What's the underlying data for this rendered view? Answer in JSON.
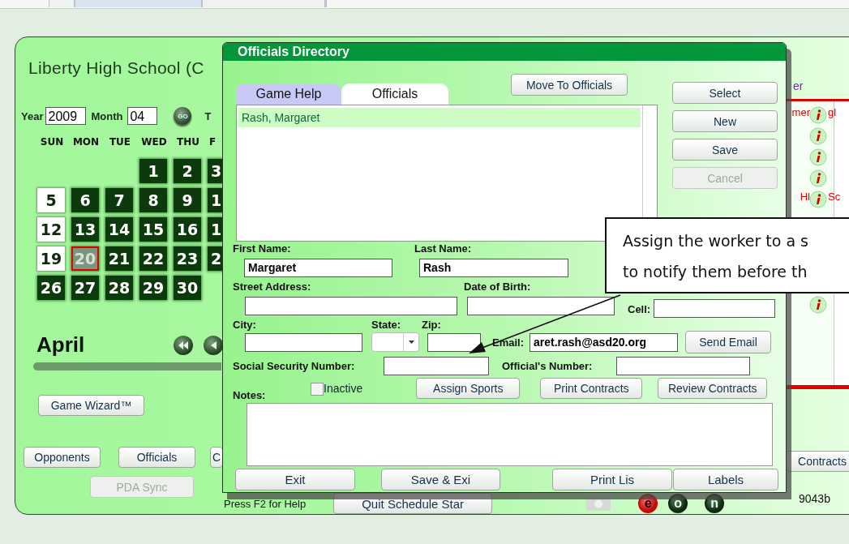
{
  "main": {
    "title": "Liberty High School (C",
    "year_label": "Year",
    "year": "2009",
    "month_label": "Month",
    "month": "04",
    "go_label": "GO",
    "to_label": "T",
    "weekdays": [
      "SUN",
      "MON",
      "TUE",
      "WED",
      "THU",
      "F"
    ],
    "weeks": [
      [
        {
          "kind": "blank"
        },
        {
          "kind": "blank"
        },
        {
          "kind": "blank"
        },
        {
          "kind": "game",
          "label": "1",
          "selected": false
        },
        {
          "kind": "game",
          "label": "2",
          "selected": false
        },
        {
          "kind": "game",
          "label": "3",
          "selected": false
        }
      ],
      [
        {
          "kind": "open",
          "label": "5",
          "selected": false
        },
        {
          "kind": "game",
          "label": "6",
          "selected": false
        },
        {
          "kind": "game",
          "label": "7",
          "selected": false
        },
        {
          "kind": "game",
          "label": "8",
          "selected": false
        },
        {
          "kind": "game",
          "label": "9",
          "selected": false
        },
        {
          "kind": "game",
          "label": "1",
          "selected": false
        }
      ],
      [
        {
          "kind": "open",
          "label": "12",
          "selected": false
        },
        {
          "kind": "game",
          "label": "13",
          "selected": false
        },
        {
          "kind": "game",
          "label": "14",
          "selected": false
        },
        {
          "kind": "game",
          "label": "15",
          "selected": false
        },
        {
          "kind": "game",
          "label": "16",
          "selected": false
        },
        {
          "kind": "game",
          "label": "1",
          "selected": false
        }
      ],
      [
        {
          "kind": "open",
          "label": "19",
          "selected": false
        },
        {
          "kind": "game",
          "label": "20",
          "selected": true
        },
        {
          "kind": "game",
          "label": "21",
          "selected": false
        },
        {
          "kind": "game",
          "label": "22",
          "selected": false
        },
        {
          "kind": "game",
          "label": "23",
          "selected": false
        },
        {
          "kind": "game",
          "label": "2",
          "selected": false
        }
      ],
      [
        {
          "kind": "game",
          "label": "26",
          "selected": false
        },
        {
          "kind": "game",
          "label": "27",
          "selected": false
        },
        {
          "kind": "game",
          "label": "28",
          "selected": false
        },
        {
          "kind": "game",
          "label": "29",
          "selected": false
        },
        {
          "kind": "game",
          "label": "30",
          "selected": false
        }
      ]
    ],
    "month_name": "April",
    "wizard_button": "Game Wizard™",
    "nav_buttons": [
      {
        "label": "Opponents",
        "disabled": false
      },
      {
        "label": "Officials",
        "disabled": false
      },
      {
        "label": "C",
        "disabled": false
      }
    ],
    "pda_button": {
      "label": "PDA Sync",
      "disabled": true
    },
    "help_text": "Press F2 for Help",
    "quit_button": "Quit Schedule Star",
    "modes": [
      {
        "label": "e",
        "selected": true
      },
      {
        "label": "o",
        "selected": false
      },
      {
        "label": "n",
        "selected": false
      }
    ],
    "version": "9043b"
  },
  "schedule": {
    "header": "er",
    "rows": [
      {
        "left": "mer",
        "right": "gl",
        "info": true
      },
      {
        "info": true
      },
      {
        "info": true
      },
      {
        "info": true
      },
      {
        "left": "Hl",
        "right": "Sc",
        "info": true
      }
    ],
    "lower_rows": [
      {
        "info": true
      }
    ],
    "contracts_button": "Contracts"
  },
  "dialog": {
    "title": "Officials Directory",
    "tabs": [
      {
        "label": "Game Help",
        "selected": false
      },
      {
        "label": "Officials",
        "selected": true
      }
    ],
    "move_button": "Move To Officials",
    "list": [
      {
        "name": "Rash, Margaret",
        "selected": true
      }
    ],
    "side_buttons": [
      {
        "label": "Select",
        "disabled": false
      },
      {
        "label": "New",
        "disabled": false
      },
      {
        "label": "Save",
        "disabled": false
      },
      {
        "label": "Cancel",
        "disabled": true
      }
    ],
    "first_name": {
      "label": "First Name:",
      "value": "Margaret"
    },
    "last_name": {
      "label": "Last Name:",
      "value": "Rash"
    },
    "street": {
      "label": "Street Address:"
    },
    "birth": {
      "label": "Date of Birth:"
    },
    "cell": {
      "label": "Cell:"
    },
    "city": {
      "label": "City:"
    },
    "state": {
      "label": "State:"
    },
    "zip": {
      "label": "Zip:"
    },
    "email": {
      "label": "Email:",
      "value": "aret.rash@asd20.org"
    },
    "send_email_button": "Send Email",
    "ssn": {
      "label": "Social Security Number:"
    },
    "official_number": {
      "label": "Official's Number:"
    },
    "inactive": {
      "label": "Inactive",
      "checked": false
    },
    "action_buttons": [
      "Assign Sports",
      "Print Contracts",
      "Review Contracts"
    ],
    "notes": {
      "label": "Notes:"
    },
    "footer_buttons": [
      "Exit",
      "Save & Exi",
      "Print Lis",
      "Labels"
    ]
  },
  "callout": {
    "lines": [
      "Assign the worker to a s",
      "to notify them before th"
    ]
  }
}
